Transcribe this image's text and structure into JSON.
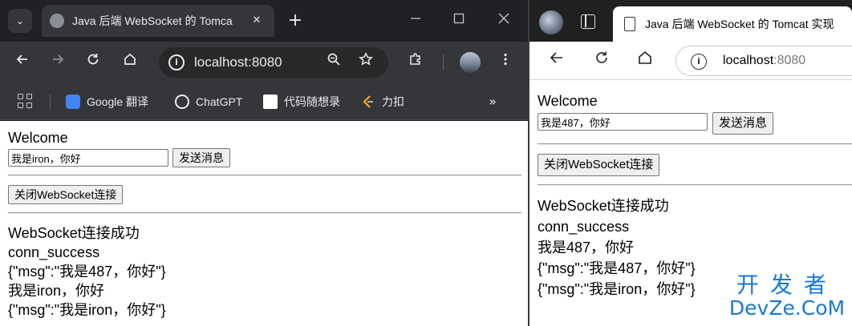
{
  "chrome": {
    "tab_title": "Java 后端 WebSocket 的 Tomcat 实现",
    "tab_close": "✕",
    "new_tab": "+",
    "url": "localhost:8080",
    "bookmarks": [
      {
        "label": "Google 翻译"
      },
      {
        "label": "ChatGPT"
      },
      {
        "label": "代码随想录"
      },
      {
        "label": "力扣"
      }
    ],
    "bookmarks_more": "»"
  },
  "edge": {
    "tab_title": "Java 后端 WebSocket 的 Tomcat 实现",
    "url_host": "localhost",
    "url_port": ":8080"
  },
  "client_a": {
    "title": "Welcome",
    "input_value": "我是iron，你好",
    "send_label": "发送消息",
    "close_label": "关闭WebSocket连接",
    "log": [
      "WebSocket连接成功",
      "conn_success",
      "{\"msg\":\"我是487，你好\"}",
      "我是iron，你好",
      "{\"msg\":\"我是iron，你好\"}"
    ]
  },
  "client_b": {
    "title": "Welcome",
    "input_value": "我是487，你好",
    "send_label": "发送消息",
    "close_label": "关闭WebSocket连接",
    "log": [
      "WebSocket连接成功",
      "conn_success",
      "我是487，你好",
      "{\"msg\":\"我是487，你好\"}",
      "{\"msg\":\"我是iron，你好\"}"
    ]
  },
  "watermark": {
    "line1": "开发者",
    "line2": "DevZe.CoM"
  }
}
